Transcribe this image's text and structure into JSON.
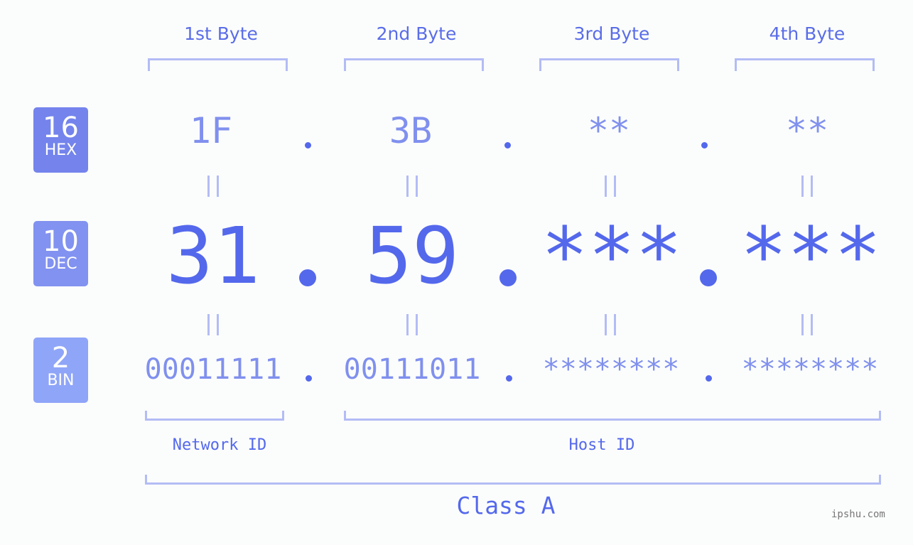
{
  "byte_headers": [
    "1st Byte",
    "2nd Byte",
    "3rd Byte",
    "4th Byte"
  ],
  "badges": [
    {
      "num": "16",
      "label": "HEX",
      "color": "#7484ec"
    },
    {
      "num": "10",
      "label": "DEC",
      "color": "#8192f0"
    },
    {
      "num": "2",
      "label": "BIN",
      "color": "#8fa5f8"
    }
  ],
  "hex": [
    "1F",
    "3B",
    "**",
    "**"
  ],
  "dec": [
    "31",
    "59",
    "***",
    "***"
  ],
  "bin": [
    "00011111",
    "00111011",
    "********",
    "********"
  ],
  "network_label": "Network ID",
  "host_label": "Host ID",
  "class_label": "Class A",
  "watermark": "ipshu.com"
}
